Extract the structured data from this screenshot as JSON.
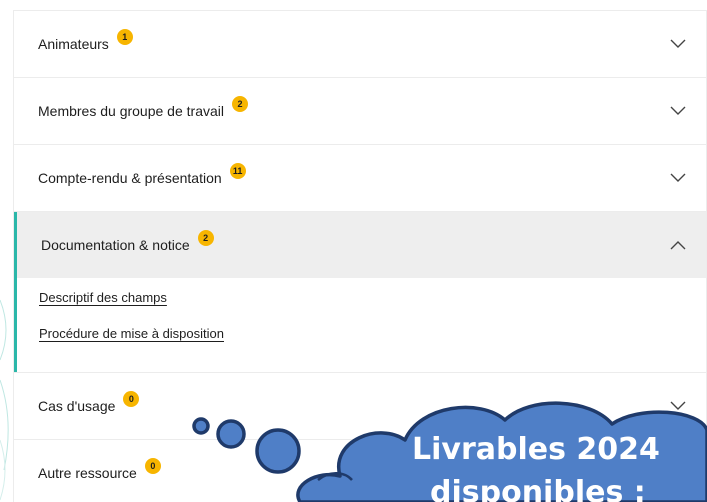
{
  "accordion": {
    "items": [
      {
        "label": "Animateurs",
        "count": "1",
        "open": false
      },
      {
        "label": "Membres du groupe de travail",
        "count": "2",
        "open": false
      },
      {
        "label": "Compte-rendu & présentation",
        "count": "11",
        "open": false
      },
      {
        "label": "Documentation & notice",
        "count": "2",
        "open": true,
        "links": [
          "Descriptif des champs",
          "Procédure de mise à disposition"
        ]
      },
      {
        "label": "Cas d'usage",
        "count": "0",
        "open": false
      },
      {
        "label": "Autre ressource",
        "count": "0",
        "open": false
      }
    ]
  },
  "callout": {
    "line1": "Livrables 2024",
    "line2": "disponibles :"
  },
  "colors": {
    "accent": "#2bb7a9",
    "badge": "#f7b500",
    "cloud_fill": "#4f7fc7",
    "cloud_stroke": "#1f3a6a",
    "open_header_bg": "#eeeeee"
  },
  "icons": {
    "collapsed": "chevron-down-icon",
    "expanded": "chevron-up-icon"
  }
}
